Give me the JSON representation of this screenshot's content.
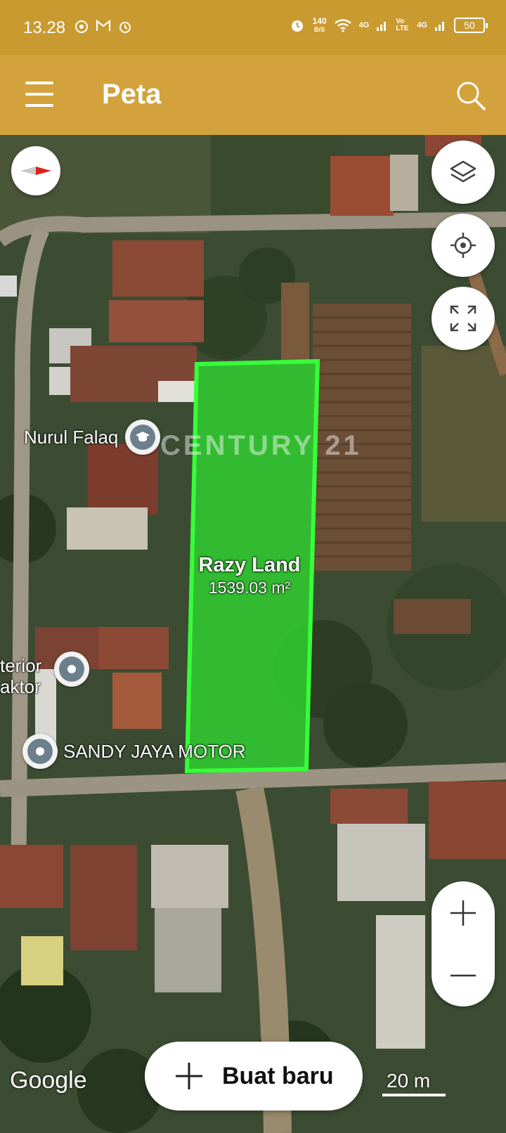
{
  "status_bar": {
    "time": "13.28",
    "notification_icons": [
      "chrome-icon",
      "gmail-icon",
      "alarm-icon"
    ],
    "data_rate": "140",
    "data_rate_unit": "B/S",
    "network_1": "4G",
    "volte": "Vo LTE",
    "network_2": "4G",
    "battery": "50"
  },
  "app_bar": {
    "title": "Peta",
    "menu_icon": "hamburger-menu-icon",
    "search_icon": "search-icon"
  },
  "map": {
    "plot": {
      "name": "Razy Land",
      "area": "1539.03 m²",
      "fill_color": "#2fd42f"
    },
    "watermark": "CENTURY 21",
    "pois": [
      {
        "label": "Nurul Falaq",
        "icon": "school-icon"
      },
      {
        "label": "terior\naktor",
        "icon": "place-pin-icon"
      },
      {
        "label": "SANDY JAYA MOTOR",
        "icon": "place-pin-icon"
      }
    ],
    "attribution": "Google",
    "scale": "20 m",
    "controls": {
      "compass": "compass-icon",
      "layers": "layers-icon",
      "locate": "my-location-icon",
      "fullscreen": "fullscreen-icon",
      "zoom_in": "+",
      "zoom_out": "−"
    }
  },
  "create_button": {
    "label": "Buat baru"
  }
}
